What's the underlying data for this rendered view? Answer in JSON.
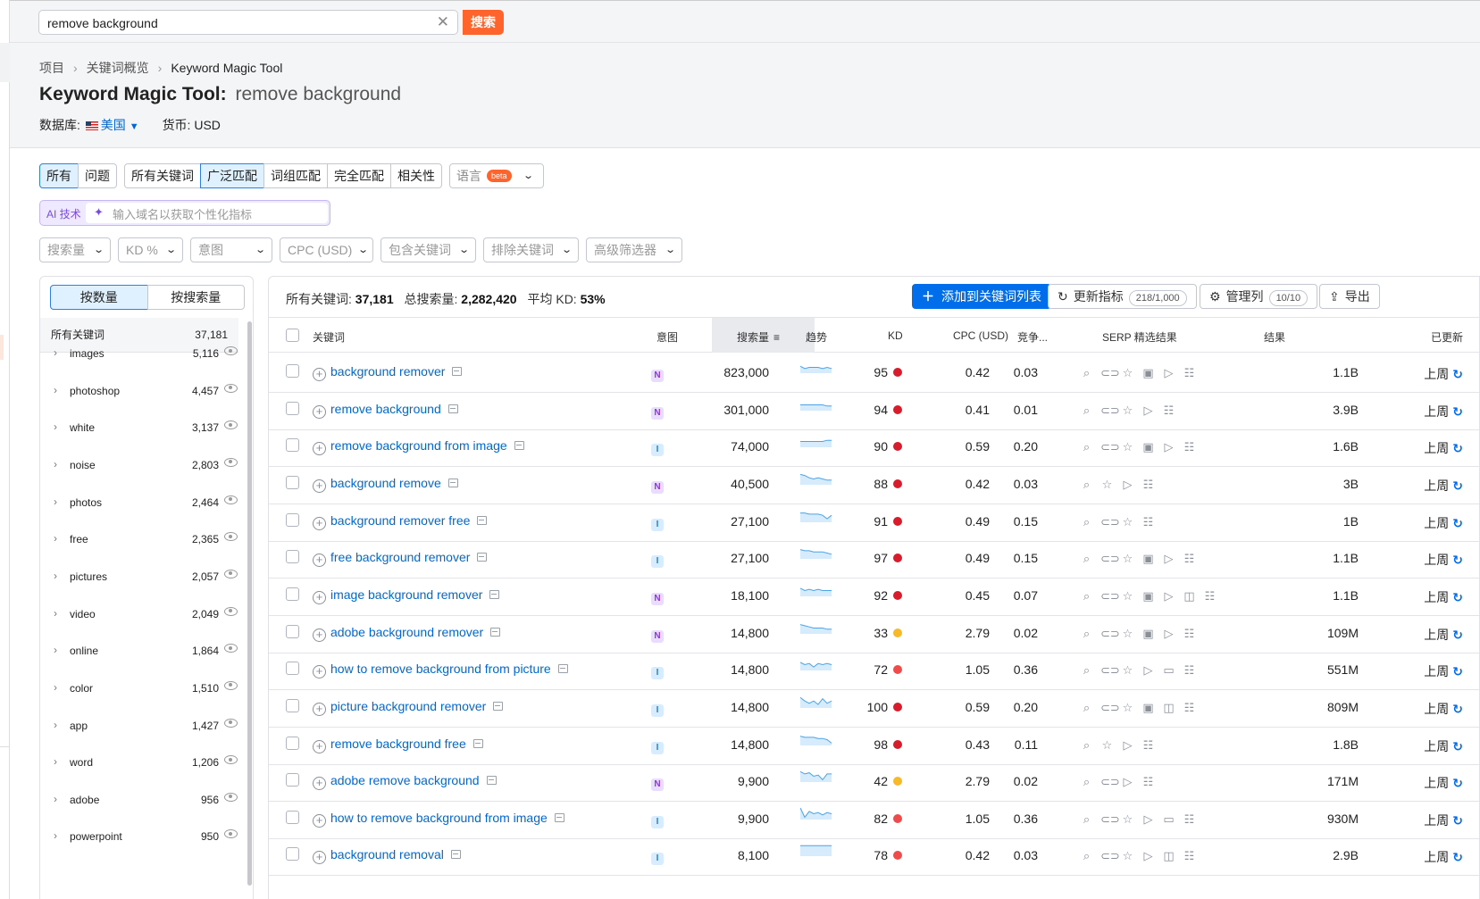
{
  "search": {
    "value": "remove background",
    "button": "搜索"
  },
  "breadcrumb": [
    "项目",
    "关键词概览",
    "Keyword Magic Tool"
  ],
  "page": {
    "title": "Keyword Magic Tool:",
    "query": "remove background",
    "db_label": "数据库:",
    "db_value": "美国",
    "currency": "货币: USD"
  },
  "tabs": {
    "g1": [
      "所有",
      "问题"
    ],
    "g2": [
      "所有关键词",
      "广泛匹配",
      "词组匹配",
      "完全匹配",
      "相关性"
    ],
    "lang": "语言",
    "beta": "beta"
  },
  "ai": {
    "label": "AI 技术",
    "placeholder": "输入域名以获取个性化指标"
  },
  "filters": [
    "搜索量",
    "KD %",
    "意图",
    "CPC (USD)",
    "包含关键词",
    "排除关键词",
    "高级筛选器"
  ],
  "sidebar": {
    "toggle": [
      "按数量",
      "按搜索量"
    ],
    "header": {
      "label": "所有关键词",
      "count": "37,181"
    },
    "items": [
      {
        "word": "images",
        "count": "5,116"
      },
      {
        "word": "photoshop",
        "count": "4,457"
      },
      {
        "word": "white",
        "count": "3,137"
      },
      {
        "word": "noise",
        "count": "2,803"
      },
      {
        "word": "photos",
        "count": "2,464"
      },
      {
        "word": "free",
        "count": "2,365"
      },
      {
        "word": "pictures",
        "count": "2,057"
      },
      {
        "word": "video",
        "count": "2,049"
      },
      {
        "word": "online",
        "count": "1,864"
      },
      {
        "word": "color",
        "count": "1,510"
      },
      {
        "word": "app",
        "count": "1,427"
      },
      {
        "word": "word",
        "count": "1,206"
      },
      {
        "word": "adobe",
        "count": "956"
      },
      {
        "word": "powerpoint",
        "count": "950"
      }
    ]
  },
  "summary": {
    "all_label": "所有关键词:",
    "all": "37,181",
    "vol_label": "总搜索量:",
    "vol": "2,282,420",
    "kd_label": "平均 KD:",
    "kd": "53%"
  },
  "actions": {
    "add": "添加到关键词列表",
    "update": "更新指标",
    "update_count": "218/1,000",
    "manage": "管理列",
    "manage_count": "10/10",
    "export": "导出"
  },
  "columns": {
    "keyword": "关键词",
    "intent": "意图",
    "volume": "搜索量",
    "trend": "趋势",
    "kd": "KD",
    "cpc": "CPC (USD)",
    "comp": "竞争...",
    "serp": "SERP 精选结果",
    "results": "结果",
    "updated": "已更新"
  },
  "colors": {
    "hard": "#d81c2b",
    "mid": "#f7b928",
    "red2": "#f04b4b"
  },
  "rows": [
    {
      "kw": "background remover",
      "intent": "N",
      "vol": "823,000",
      "kd": "95",
      "kdc": "hard",
      "cpc": "0.42",
      "comp": "0.03",
      "serp": [
        "serp-icon",
        "link-icon",
        "star-icon",
        "image-icon",
        "video-icon",
        "list-icon"
      ],
      "res": "1.1B",
      "upd": "上周",
      "trend": [
        6,
        4,
        5,
        5,
        5,
        4,
        5,
        4
      ]
    },
    {
      "kw": "remove background",
      "intent": "N",
      "vol": "301,000",
      "kd": "94",
      "kdc": "hard",
      "cpc": "0.41",
      "comp": "0.01",
      "serp": [
        "serp-icon",
        "link-icon",
        "star-icon",
        "video-icon",
        "list-icon"
      ],
      "res": "3.9B",
      "upd": "上周",
      "trend": [
        5,
        5,
        5,
        5,
        5,
        5,
        4,
        4
      ]
    },
    {
      "kw": "remove background from image",
      "intent": "I",
      "vol": "74,000",
      "kd": "90",
      "kdc": "hard",
      "cpc": "0.59",
      "comp": "0.20",
      "serp": [
        "serp-icon",
        "link-icon",
        "star-icon",
        "image-icon",
        "video-icon",
        "list-icon"
      ],
      "res": "1.6B",
      "upd": "上周",
      "trend": [
        5,
        5,
        5,
        5,
        5,
        5,
        6,
        6
      ]
    },
    {
      "kw": "background remove",
      "intent": "N",
      "vol": "40,500",
      "kd": "88",
      "kdc": "hard",
      "cpc": "0.42",
      "comp": "0.03",
      "serp": [
        "serp-icon",
        "star-icon",
        "video-icon",
        "list-icon"
      ],
      "res": "3B",
      "upd": "上周",
      "trend": [
        9,
        8,
        6,
        5,
        6,
        5,
        4,
        4
      ]
    },
    {
      "kw": "background remover free",
      "intent": "I",
      "vol": "27,100",
      "kd": "91",
      "kdc": "hard",
      "cpc": "0.49",
      "comp": "0.15",
      "serp": [
        "serp-icon",
        "link-icon",
        "star-icon",
        "list-icon"
      ],
      "res": "1B",
      "upd": "上周",
      "trend": [
        8,
        8,
        7,
        7,
        7,
        6,
        3,
        6
      ]
    },
    {
      "kw": "free background remover",
      "intent": "I",
      "vol": "27,100",
      "kd": "97",
      "kdc": "hard",
      "cpc": "0.49",
      "comp": "0.15",
      "serp": [
        "serp-icon",
        "link-icon",
        "star-icon",
        "image-icon",
        "video-icon",
        "list-icon"
      ],
      "res": "1.1B",
      "upd": "上周",
      "trend": [
        8,
        7,
        7,
        6,
        6,
        6,
        5,
        4
      ]
    },
    {
      "kw": "image background remover",
      "intent": "N",
      "vol": "18,100",
      "kd": "92",
      "kdc": "hard",
      "cpc": "0.45",
      "comp": "0.07",
      "serp": [
        "serp-icon",
        "link-icon",
        "star-icon",
        "image-icon",
        "video-icon",
        "carousel-icon",
        "list-icon"
      ],
      "res": "1.1B",
      "upd": "上周",
      "trend": [
        7,
        5,
        6,
        5,
        6,
        5,
        5,
        5
      ]
    },
    {
      "kw": "adobe background remover",
      "intent": "N",
      "vol": "14,800",
      "kd": "33",
      "kdc": "mid",
      "cpc": "2.79",
      "comp": "0.02",
      "serp": [
        "serp-icon",
        "link-icon",
        "star-icon",
        "image-icon",
        "video-icon",
        "list-icon"
      ],
      "res": "109M",
      "upd": "上周",
      "trend": [
        8,
        7,
        6,
        5,
        5,
        5,
        4,
        4
      ]
    },
    {
      "kw": "how to remove background from picture",
      "intent": "I",
      "vol": "14,800",
      "kd": "72",
      "kdc": "red2",
      "cpc": "1.05",
      "comp": "0.36",
      "serp": [
        "serp-icon",
        "link-icon",
        "star-icon",
        "video-icon",
        "comment-icon",
        "list-icon"
      ],
      "res": "551M",
      "upd": "上周",
      "trend": [
        7,
        5,
        6,
        3,
        6,
        5,
        6,
        5
      ]
    },
    {
      "kw": "picture background remover",
      "intent": "I",
      "vol": "14,800",
      "kd": "100",
      "kdc": "hard",
      "cpc": "0.59",
      "comp": "0.20",
      "serp": [
        "serp-icon",
        "link-icon",
        "star-icon",
        "image-icon",
        "carousel-icon",
        "list-icon"
      ],
      "res": "809M",
      "upd": "上周",
      "trend": [
        9,
        6,
        4,
        6,
        3,
        8,
        4,
        6
      ]
    },
    {
      "kw": "remove background free",
      "intent": "I",
      "vol": "14,800",
      "kd": "98",
      "kdc": "hard",
      "cpc": "0.43",
      "comp": "0.11",
      "serp": [
        "serp-icon",
        "star-icon",
        "video-icon",
        "list-icon"
      ],
      "res": "1.8B",
      "upd": "上周",
      "trend": [
        8,
        7,
        7,
        7,
        6,
        6,
        5,
        2
      ]
    },
    {
      "kw": "adobe remove background",
      "intent": "N",
      "vol": "9,900",
      "kd": "42",
      "kdc": "mid",
      "cpc": "2.79",
      "comp": "0.02",
      "serp": [
        "serp-icon",
        "link-icon",
        "video-icon",
        "list-icon"
      ],
      "res": "171M",
      "upd": "上周",
      "trend": [
        9,
        7,
        8,
        5,
        6,
        2,
        7,
        7
      ]
    },
    {
      "kw": "how to remove background from image",
      "intent": "I",
      "vol": "9,900",
      "kd": "82",
      "kdc": "red2",
      "cpc": "1.05",
      "comp": "0.36",
      "serp": [
        "serp-icon",
        "link-icon",
        "star-icon",
        "video-icon",
        "comment-icon",
        "list-icon"
      ],
      "res": "930M",
      "upd": "上周",
      "trend": [
        10,
        2,
        7,
        5,
        6,
        4,
        6,
        5
      ]
    },
    {
      "kw": "background removal",
      "intent": "I",
      "vol": "8,100",
      "kd": "78",
      "kdc": "red2",
      "cpc": "0.42",
      "comp": "0.03",
      "serp": [
        "serp-icon",
        "link-icon",
        "star-icon",
        "video-icon",
        "carousel-icon",
        "list-icon"
      ],
      "res": "2.9B",
      "upd": "上周",
      "trend": [
        9,
        9,
        9,
        9,
        9,
        9,
        9,
        9
      ]
    }
  ]
}
